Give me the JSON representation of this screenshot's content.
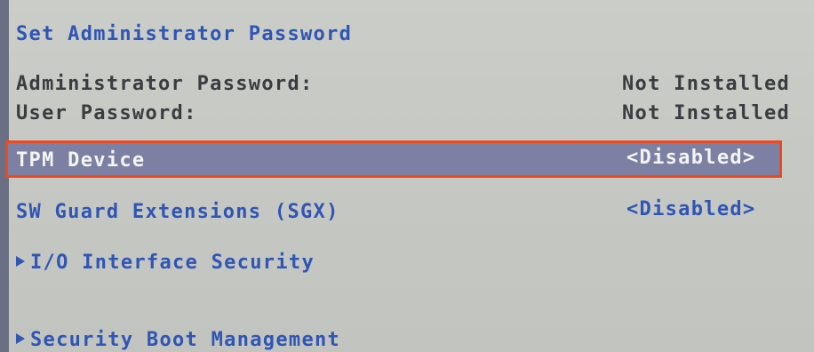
{
  "menu": {
    "set_admin_password": "Set Administrator Password",
    "admin_password_label": "Administrator Password:",
    "admin_password_value": "Not Installed",
    "user_password_label": "User Password:",
    "user_password_value": "Not Installed",
    "tpm_device_label": "TPM Device",
    "tpm_device_value": "<Disabled>",
    "sgx_label": "SW Guard Extensions (SGX)",
    "sgx_value": "<Disabled>",
    "io_security_label": "I/O Interface Security",
    "security_boot_label": "Security Boot Management"
  },
  "colors": {
    "item_blue": "#2f55b5",
    "highlight_bg": "#7c81a3",
    "highlight_border": "#f0471c",
    "static_text": "#3a3d40"
  }
}
